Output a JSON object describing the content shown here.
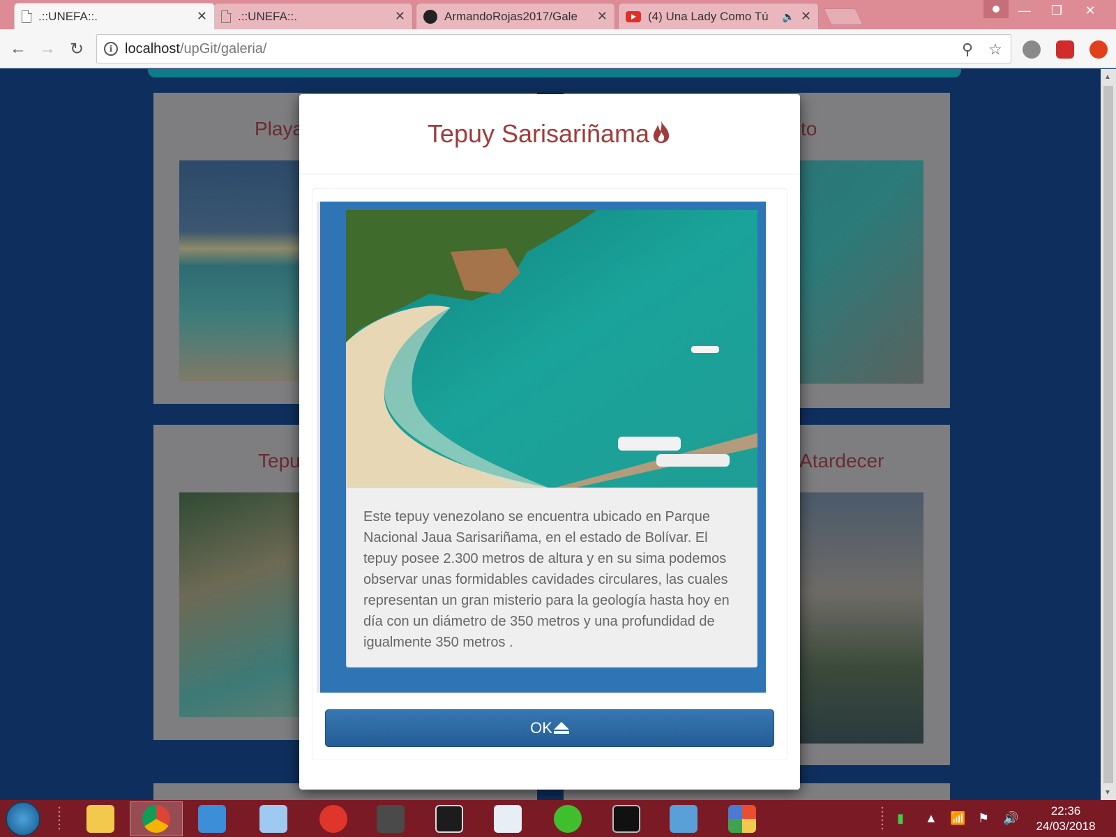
{
  "browser": {
    "tabs": [
      {
        "title": ".::UNEFA::.",
        "favicon": "page-icon",
        "active": true
      },
      {
        "title": ".::UNEFA::.",
        "favicon": "page-icon",
        "active": false
      },
      {
        "title": "ArmandoRojas2017/Gale",
        "favicon": "github-icon",
        "active": false
      },
      {
        "title": "(4) Una Lady Como Tú",
        "favicon": "youtube-icon",
        "active": false
      }
    ],
    "address": {
      "host": "localhost",
      "path": "/upGit/galeria/"
    },
    "window_controls": {
      "minimize": "—",
      "maximize": "❐",
      "close": "✕"
    }
  },
  "gallery": {
    "cards": [
      {
        "title": "Playa"
      },
      {
        "title": "to"
      },
      {
        "title": "Tepu"
      },
      {
        "title": "al Atardecer"
      }
    ]
  },
  "modal": {
    "title": "Tepuy Sarisariñama",
    "description": "Este tepuy venezolano se encuentra ubicado en Parque Nacional Jaua Sarisariñama, en el estado de Bolívar. El tepuy posee 2.300 metros de altura y en su sima podemos observar unas formidables cavidades circulares, las cuales representan un gran misterio para la geología hasta hoy en día con un diámetro de 350 metros y una profundidad de igualmente 350 metros .",
    "ok_label": "OK",
    "accent_color": "#a23b3b",
    "panel_color": "#2f75b6"
  },
  "taskbar": {
    "time": "22:36",
    "date": "24/03/2018"
  }
}
